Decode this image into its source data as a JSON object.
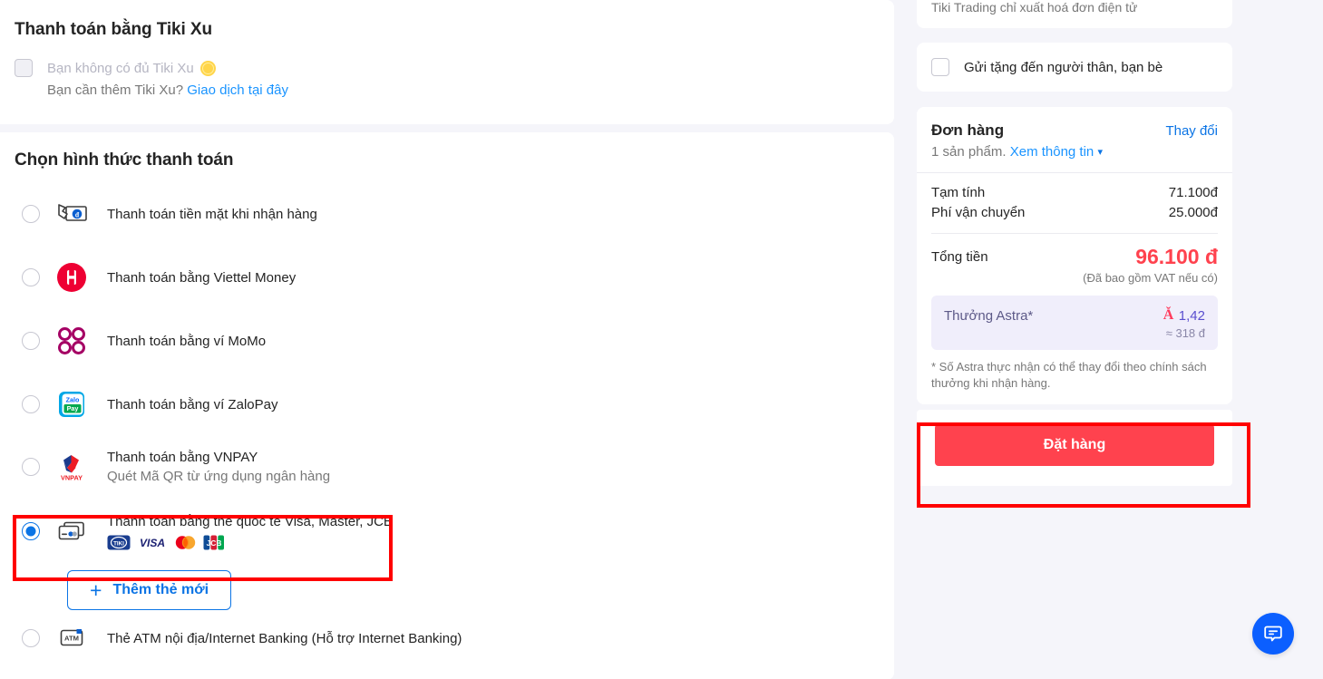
{
  "tikixu": {
    "title": "Thanh toán bằng Tiki Xu",
    "checkbox_label": "Bạn không có đủ Tiki Xu",
    "sub_prefix": "Bạn cần thêm Tiki Xu? ",
    "sub_link": "Giao dịch tại đây",
    "coin_icon": "tiki-xu-coin-icon"
  },
  "payment": {
    "title": "Chọn hình thức thanh toán",
    "methods": [
      {
        "id": "cod",
        "label": "Thanh toán tiền mặt khi nhận hàng",
        "sub": "",
        "icon": "cash-on-delivery-icon",
        "selected": false
      },
      {
        "id": "viettel",
        "label": "Thanh toán bằng Viettel Money",
        "sub": "",
        "icon": "viettel-money-icon",
        "selected": false
      },
      {
        "id": "momo",
        "label": "Thanh toán bằng ví MoMo",
        "sub": "",
        "icon": "momo-icon",
        "selected": false
      },
      {
        "id": "zalopay",
        "label": "Thanh toán bằng ví ZaloPay",
        "sub": "",
        "icon": "zalopay-icon",
        "selected": false
      },
      {
        "id": "vnpay",
        "label": "Thanh toán bằng VNPAY",
        "sub": "Quét Mã QR từ ứng dụng ngân hàng",
        "icon": "vnpay-icon",
        "selected": false
      },
      {
        "id": "intlcard",
        "label": "Thanh toán bằng thẻ quốc tế Visa, Master, JCB",
        "sub": "",
        "icon": "credit-card-icon",
        "selected": true
      },
      {
        "id": "atm",
        "label": "Thẻ ATM nội địa/Internet Banking (Hỗ trợ Internet Banking)",
        "sub": "",
        "icon": "atm-card-icon",
        "selected": false
      }
    ],
    "card_brands": [
      "tiki-card-logo",
      "visa-logo",
      "mastercard-logo",
      "jcb-logo"
    ],
    "add_card_button": "Thêm thẻ mới",
    "add_card_icon": "plus-icon"
  },
  "sidebar": {
    "invoice_note": "Tiki Trading chỉ xuất hoá đơn điện tử",
    "gift_label": "Gửi tặng đến người thân, bạn bè",
    "order": {
      "title": "Đơn hàng",
      "change_label": "Thay đổi",
      "items_count_text": "1 sản phẩm. ",
      "details_link": "Xem thông tin",
      "chevron_icon": "chevron-down-icon",
      "rows": [
        {
          "label": "Tạm tính",
          "value": "71.100đ"
        },
        {
          "label": "Phí vận chuyển",
          "value": "25.000đ"
        }
      ],
      "total_label": "Tổng tiền",
      "total_value": "96.100 đ",
      "vat_note": "(Đã bao gồm VAT nếu có)",
      "astra_label": "Thưởng Astra*",
      "astra_icon": "astra-logo-icon",
      "astra_value": "1,42",
      "astra_approx": "≈ 318 đ",
      "astra_footnote": "* Số Astra thực nhận có thể thay đổi theo chính sách thưởng khi nhận hàng.",
      "submit_label": "Đặt hàng"
    }
  },
  "chat": {
    "icon": "chat-bubble-icon"
  },
  "colors": {
    "accent_blue": "#0b74e5",
    "brand_red": "#ff424e",
    "highlight": "#ff0000",
    "page_bg": "#f5f5fa",
    "astra_bg": "#f0eefb"
  }
}
